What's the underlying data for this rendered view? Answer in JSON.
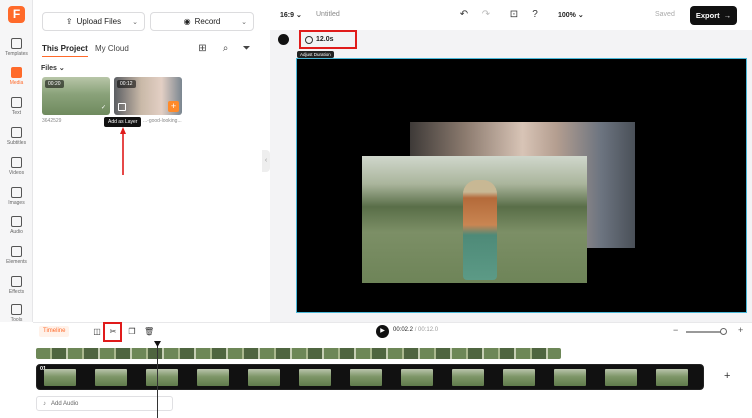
{
  "app": {
    "logo_letter": "F"
  },
  "rail": {
    "items": [
      {
        "label": "Templates",
        "icon": "templates-icon",
        "active": false
      },
      {
        "label": "Media",
        "icon": "media-icon",
        "active": true
      },
      {
        "label": "Text",
        "icon": "text-icon",
        "active": false
      },
      {
        "label": "Subtitles",
        "icon": "subtitles-icon",
        "active": false
      },
      {
        "label": "Videos",
        "icon": "videos-icon",
        "active": false
      },
      {
        "label": "Images",
        "icon": "images-icon",
        "active": false
      },
      {
        "label": "Audio",
        "icon": "audio-icon",
        "active": false
      },
      {
        "label": "Elements",
        "icon": "elements-icon",
        "active": false
      },
      {
        "label": "Effects",
        "icon": "effects-icon",
        "active": false
      },
      {
        "label": "Tools",
        "icon": "tools-icon",
        "active": false
      }
    ]
  },
  "panel": {
    "upload_label": "Upload Files",
    "record_label": "Record",
    "tab_project": "This Project",
    "tab_cloud": "My Cloud",
    "files_label": "Files",
    "files": [
      {
        "duration": "00:20",
        "name": "3642529"
      },
      {
        "duration": "00:12",
        "name": "...-good-looking..."
      }
    ],
    "tooltip_add_layer": "Add as Layer"
  },
  "topbar": {
    "ratio": "16:9",
    "title": "Untitled",
    "zoom": "100%",
    "saved": "Saved",
    "export_label": "Export"
  },
  "canvas": {
    "duration_value": "12.0s",
    "duration_tooltip": "Adjust Duration"
  },
  "timeline": {
    "timeline_label": "Timeline",
    "current_time": "00:02.2",
    "total_time": "/ 00:12.0",
    "track_label": "01",
    "add_audio_label": "Add Audio"
  },
  "colors": {
    "accent": "#ff6a2a",
    "highlight_box": "#e01b1b",
    "canvas_border": "#4ab8d8"
  }
}
